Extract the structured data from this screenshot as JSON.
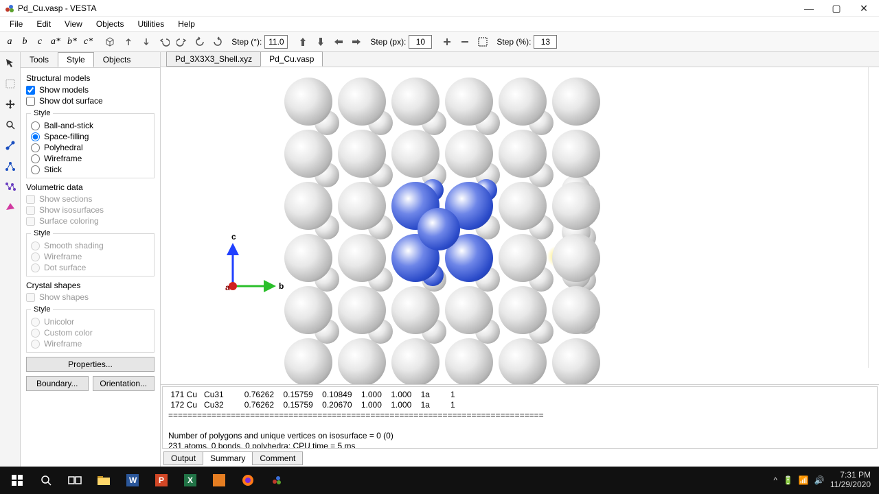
{
  "window": {
    "title": "Pd_Cu.vasp - VESTA"
  },
  "menu": {
    "file": "File",
    "edit": "Edit",
    "view": "View",
    "objects": "Objects",
    "utilities": "Utilities",
    "help": "Help"
  },
  "viewbtns": {
    "a": "a",
    "b": "b",
    "c": "c",
    "as": "a*",
    "bs": "b*",
    "cs": "c*"
  },
  "toolbar": {
    "step_deg_label": "Step (°):",
    "step_deg": "11.0",
    "step_px_label": "Step (px):",
    "step_px": "10",
    "step_pct_label": "Step (%):",
    "step_pct": "13"
  },
  "sidebar": {
    "tabs": {
      "tools": "Tools",
      "style": "Style",
      "objects": "Objects"
    },
    "structural": {
      "title": "Structural models",
      "show_models": "Show models",
      "show_dot": "Show dot surface",
      "style": "Style",
      "ball": "Ball-and-stick",
      "space": "Space-filling",
      "poly": "Polyhedral",
      "wire": "Wireframe",
      "stick": "Stick"
    },
    "volumetric": {
      "title": "Volumetric data",
      "sections": "Show sections",
      "iso": "Show isosurfaces",
      "surf": "Surface coloring",
      "style": "Style",
      "smooth": "Smooth shading",
      "wire": "Wireframe",
      "dot": "Dot surface"
    },
    "crystal": {
      "title": "Crystal shapes",
      "show": "Show shapes",
      "style": "Style",
      "uni": "Unicolor",
      "custom": "Custom color",
      "wire": "Wireframe"
    },
    "buttons": {
      "properties": "Properties...",
      "boundary": "Boundary...",
      "orientation": "Orientation..."
    }
  },
  "tabs": {
    "t1": "Pd_3X3X3_Shell.xyz",
    "t2": "Pd_Cu.vasp"
  },
  "axis": {
    "b": "b",
    "c": "c",
    "a": "a"
  },
  "output": {
    "line1": " 171 Cu   Cu31         0.76262    0.15759    0.10849    1.000    1.000    1a         1",
    "line2": " 172 Cu   Cu32         0.76262    0.15759    0.20670    1.000    1.000    1a         1",
    "sep": "==============================================================================",
    "blank": "",
    "line3": "Number of polygons and unique vertices on isosurface = 0 (0)",
    "line4": "231 atoms, 0 bonds, 0 polyhedra; CPU time = 5 ms",
    "tabs": {
      "output": "Output",
      "summary": "Summary",
      "comment": "Comment"
    }
  },
  "tray": {
    "time": "7:31 PM",
    "date": "11/29/2020"
  }
}
